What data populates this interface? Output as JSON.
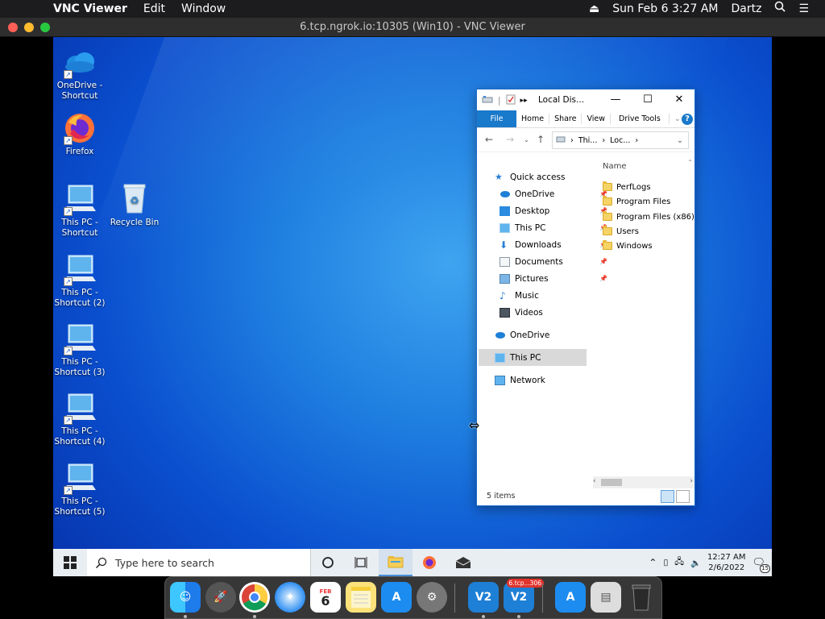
{
  "mac_menubar": {
    "app": "VNC Viewer",
    "menus": [
      "Edit",
      "Window"
    ],
    "datetime": "Sun Feb 6  3:27 AM",
    "user": "Dartz"
  },
  "vnc_window": {
    "title": "6.tcp.ngrok.io:10305 (Win10) - VNC Viewer"
  },
  "desktop_icons": [
    {
      "label": "OneDrive - Shortcut",
      "icon": "onedrive-icon"
    },
    {
      "label": "Firefox",
      "icon": "firefox-icon"
    },
    {
      "label": "This PC - Shortcut",
      "icon": "this-pc-icon"
    },
    {
      "label": "Recycle Bin",
      "icon": "recycle-bin-icon"
    },
    {
      "label": "This PC - Shortcut (2)",
      "icon": "this-pc-icon"
    },
    {
      "label": "This PC - Shortcut (3)",
      "icon": "this-pc-icon"
    },
    {
      "label": "This PC - Shortcut (4)",
      "icon": "this-pc-icon"
    },
    {
      "label": "This PC - Shortcut (5)",
      "icon": "this-pc-icon"
    }
  ],
  "explorer": {
    "title": "Local Dis...",
    "ribbon_tabs": [
      "File",
      "Home",
      "Share",
      "View",
      "Drive Tools"
    ],
    "address": {
      "crumb1": "Thi...",
      "crumb2": "Loc..."
    },
    "nav_pane": [
      {
        "label": "Quick access",
        "pinned": false,
        "selected": false
      },
      {
        "label": "OneDrive",
        "pinned": true,
        "selected": false
      },
      {
        "label": "Desktop",
        "pinned": true,
        "selected": false
      },
      {
        "label": "This PC",
        "pinned": true,
        "selected": false
      },
      {
        "label": "Downloads",
        "pinned": true,
        "selected": false
      },
      {
        "label": "Documents",
        "pinned": true,
        "selected": false
      },
      {
        "label": "Pictures",
        "pinned": true,
        "selected": false
      },
      {
        "label": "Music",
        "pinned": false,
        "selected": false
      },
      {
        "label": "Videos",
        "pinned": false,
        "selected": false
      },
      {
        "label": "OneDrive",
        "pinned": false,
        "selected": false
      },
      {
        "label": "This PC",
        "pinned": false,
        "selected": true
      },
      {
        "label": "Network",
        "pinned": false,
        "selected": false
      }
    ],
    "column_header": "Name",
    "files": [
      "PerfLogs",
      "Program Files",
      "Program Files (x86)",
      "Users",
      "Windows"
    ],
    "status": "5 items"
  },
  "win_taskbar": {
    "search_placeholder": "Type here to search",
    "time": "12:27 AM",
    "date": "2/6/2022",
    "notification_count": "15"
  },
  "dock": {
    "calendar_month": "FEB",
    "calendar_day": "6",
    "vnc_badge": "6.tcp...306"
  },
  "colors": {
    "accent": "#1979ca",
    "desktop_blue": "#1f7fe0"
  }
}
